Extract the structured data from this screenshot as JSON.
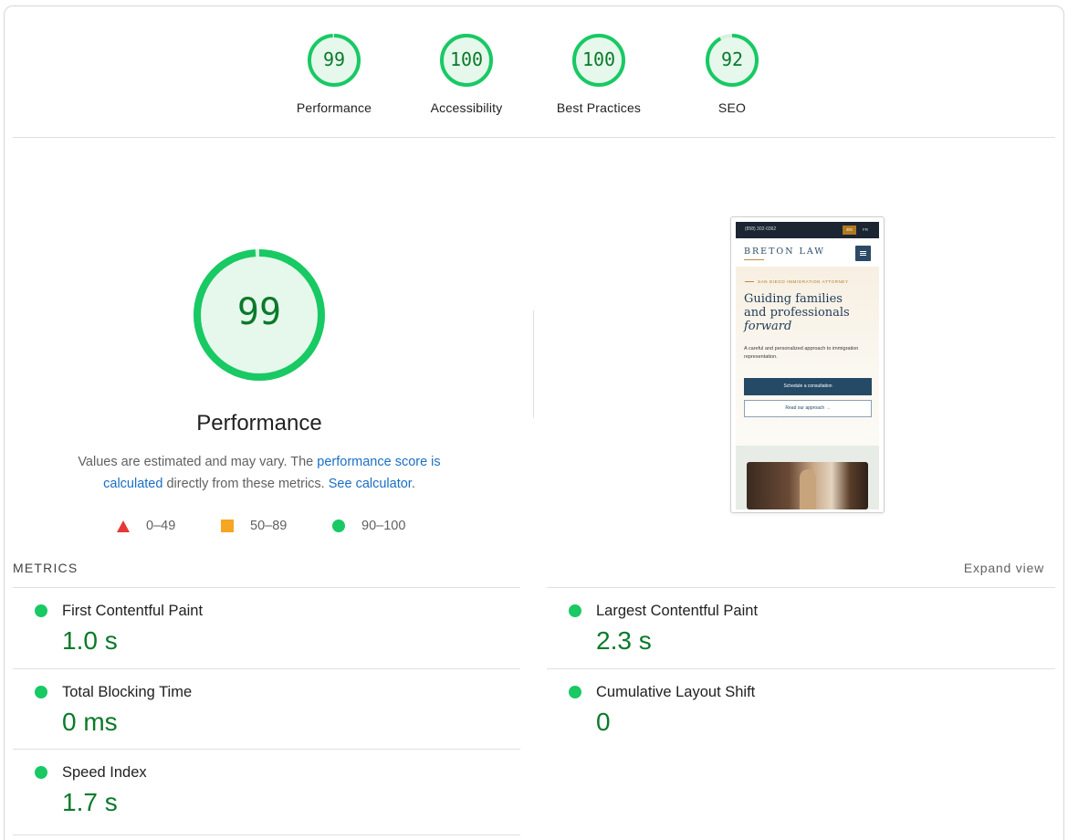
{
  "categories": [
    {
      "label": "Performance",
      "score": 99
    },
    {
      "label": "Accessibility",
      "score": 100
    },
    {
      "label": "Best Practices",
      "score": 100
    },
    {
      "label": "SEO",
      "score": 92
    }
  ],
  "colors": {
    "pass": "#18c964",
    "pass_text": "#0a7a2a",
    "pass_fill": "#e6f8ec",
    "average": "#f5a623",
    "fail": "#e53935",
    "link": "#1a6fc4"
  },
  "main": {
    "score": 99,
    "title": "Performance",
    "desc_pre": "Values are estimated and may vary. The ",
    "desc_link1": "performance score is calculated",
    "desc_mid": " directly from these metrics. ",
    "desc_link2": "See calculator",
    "desc_post": "."
  },
  "legend": [
    {
      "range": "0–49",
      "icon": "triangle-icon"
    },
    {
      "range": "50–89",
      "icon": "square-icon"
    },
    {
      "range": "90–100",
      "icon": "circle-icon"
    }
  ],
  "screenshot": {
    "phone": "(858) 302-0362",
    "lang_en": "EN",
    "lang_fr": "FR",
    "brand": "BRETON LAW",
    "eyebrow": "SAN DIEGO IMMIGRATION ATTORNEY",
    "headline_1": "Guiding families",
    "headline_2": "and professionals",
    "headline_3": "forward",
    "subtext": "A careful and personalized approach to immigration representation.",
    "cta_primary": "Schedule a consultation",
    "cta_secondary": "Read our approach →"
  },
  "metrics": {
    "heading": "METRICS",
    "expand_label": "Expand view",
    "items": [
      {
        "label": "First Contentful Paint",
        "value": "1.0 s"
      },
      {
        "label": "Largest Contentful Paint",
        "value": "2.3 s"
      },
      {
        "label": "Total Blocking Time",
        "value": "0 ms"
      },
      {
        "label": "Cumulative Layout Shift",
        "value": "0"
      },
      {
        "label": "Speed Index",
        "value": "1.7 s"
      }
    ]
  }
}
